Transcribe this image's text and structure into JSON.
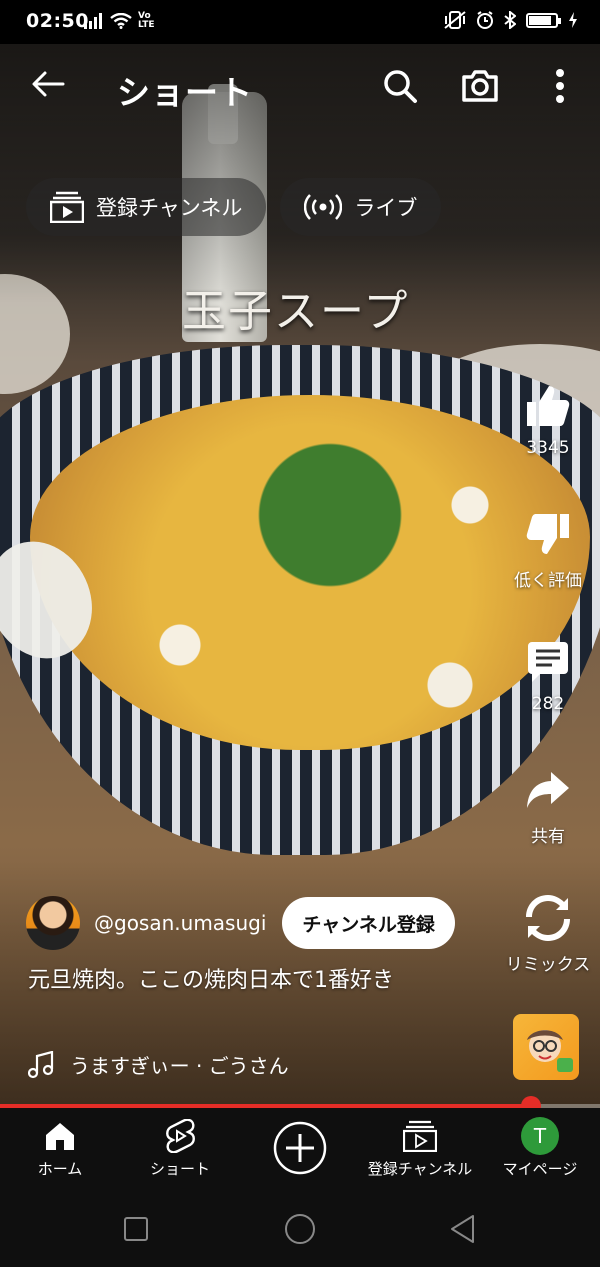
{
  "status_bar": {
    "time": "02:50",
    "volte": "Vo\nLTE",
    "battery_level": 0.85,
    "icons": [
      "signal-icon",
      "wifi-icon",
      "volte-icon",
      "vibrate-icon",
      "alarm-icon",
      "bluetooth-icon",
      "battery-icon",
      "charging-icon"
    ]
  },
  "header": {
    "title": "ショート",
    "icons": [
      "back-arrow-icon",
      "search-icon",
      "camera-icon",
      "more-vert-icon"
    ]
  },
  "chips": [
    {
      "label": "登録チャンネル",
      "icon": "subscriptions-icon"
    },
    {
      "label": "ライブ",
      "icon": "live-icon"
    }
  ],
  "video": {
    "overlay_caption": "玉子スープ",
    "title": "元旦焼肉。ここの焼肉日本で1番好き",
    "music": "うますぎぃー · ごうさん",
    "progress": 0.885
  },
  "channel": {
    "handle": "@gosan.umasugi",
    "subscribe_label": "チャンネル登録"
  },
  "actions": {
    "like_count": "3345",
    "dislike_label": "低く評価",
    "comment_count": "282",
    "share_label": "共有",
    "remix_label": "リミックス"
  },
  "bottom_nav": [
    {
      "label": "ホーム",
      "icon": "home-icon"
    },
    {
      "label": "ショート",
      "icon": "shorts-icon"
    },
    {
      "label": "",
      "icon": "create-plus-icon"
    },
    {
      "label": "登録チャンネル",
      "icon": "subscriptions-icon"
    },
    {
      "label": "マイページ",
      "icon": "avatar",
      "avatar_letter": "T"
    }
  ],
  "colors": {
    "accent_red": "#e52d27",
    "avatar_green": "#2e9a3a",
    "nav_bg": "#0f0f0f"
  }
}
